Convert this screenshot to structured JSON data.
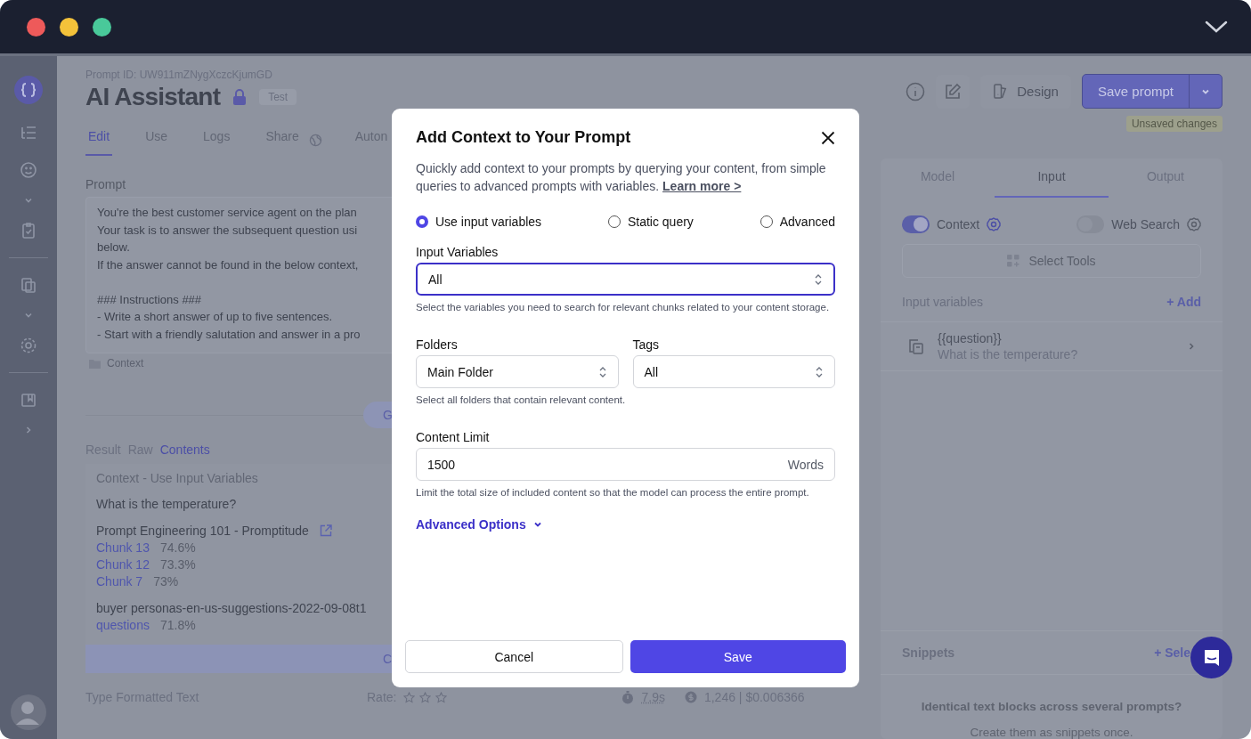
{
  "prompt_id": "Prompt ID: UW911mZNygXczcKjumGD",
  "title": "AI Assistant",
  "badge": "Test",
  "tabs": [
    {
      "label": "Edit",
      "selected": true,
      "kind": "plain"
    },
    {
      "label": "Use",
      "selected": false,
      "kind": "plain"
    },
    {
      "label": "Logs",
      "selected": false,
      "kind": "plain"
    },
    {
      "label": "Share",
      "selected": false,
      "kind": "globe"
    },
    {
      "label": "Auton",
      "selected": false,
      "kind": "plain"
    }
  ],
  "prompt": {
    "label": "Prompt",
    "lines": [
      "You're the best customer service agent on the plan",
      "Your task is to answer the subsequent question usi",
      "below.",
      "If the answer cannot be found in the below context,"
    ],
    "instructions": [
      "### Instructions ###",
      "- Write a short answer of up to five sentences.",
      "- Start with a friendly salutation and answer in a pro"
    ],
    "context_label": "Context"
  },
  "partial_button": "G",
  "result_tabs": [
    {
      "label": "Result",
      "selected": false
    },
    {
      "label": "Raw",
      "selected": false
    },
    {
      "label": "Contents",
      "selected": true
    }
  ],
  "contents": {
    "heading": "Context - Use Input Variables",
    "question": "What is the temperature?",
    "sources": [
      {
        "title": "Prompt Engineering 101 - Promptitude",
        "link": true,
        "chunks": [
          {
            "name": "Chunk 13",
            "score": "74.6%"
          },
          {
            "name": "Chunk 12",
            "score": "73.3%"
          },
          {
            "name": "Chunk 7",
            "score": "73%"
          }
        ]
      },
      {
        "title": "buyer personas-en-us-suggestions-2022-09-08t1",
        "link": false,
        "chunks": [
          {
            "name": "questions",
            "score": "71.8%"
          }
        ]
      }
    ]
  },
  "bottom_bar": "C",
  "footer": {
    "placeholder": "Type Formatted Text",
    "rate_label": "Rate:",
    "stars": 0,
    "time": "7.9s",
    "usage": "1,246 | $0.006366"
  },
  "toolbar": {
    "design": "Design",
    "save": "Save prompt",
    "unsaved": "Unsaved changes"
  },
  "panel": {
    "tabs": [
      {
        "label": "Model",
        "selected": false
      },
      {
        "label": "Input",
        "selected": true
      },
      {
        "label": "Output",
        "selected": false
      }
    ],
    "tools": [
      {
        "label": "Context",
        "on": true
      },
      {
        "label": "Web Search",
        "on": false
      }
    ],
    "select_tools": "Select Tools",
    "variables_label": "Input variables",
    "add": "+ Add",
    "variables": [
      {
        "name": "{{question}}",
        "value": "What is the temperature?"
      }
    ],
    "snippets": "Snippets",
    "snippets_add": "+ Sele",
    "empty_title": "Identical text blocks across several prompts?",
    "empty_text": "Create them as snippets once."
  },
  "modal": {
    "title": "Add Context to Your Prompt",
    "description": "Quickly add context to your prompts by querying your content, from simple queries to advanced prompts with variables.",
    "link": "Learn more >",
    "modes": [
      {
        "label": "Use input variables",
        "selected": true
      },
      {
        "label": "Static query",
        "selected": false
      },
      {
        "label": "Advanced",
        "selected": false
      }
    ],
    "input_variables": {
      "label": "Input Variables",
      "value": "All",
      "focused": true,
      "hint": "Select the variables you need to search for relevant chunks related to your content storage."
    },
    "folders": {
      "label": "Folders",
      "value": "Main Folder",
      "focused": false
    },
    "tags": {
      "label": "Tags",
      "value": "All",
      "focused": false
    },
    "folders_hint": "Select all folders that contain relevant content.",
    "content_limit": {
      "label": "Content Limit",
      "value": "1500",
      "unit": "Words",
      "hint": "Limit the total size of included content so that the model can process the entire prompt."
    },
    "advanced": "Advanced Options",
    "cancel": "Cancel",
    "save": "Save"
  }
}
